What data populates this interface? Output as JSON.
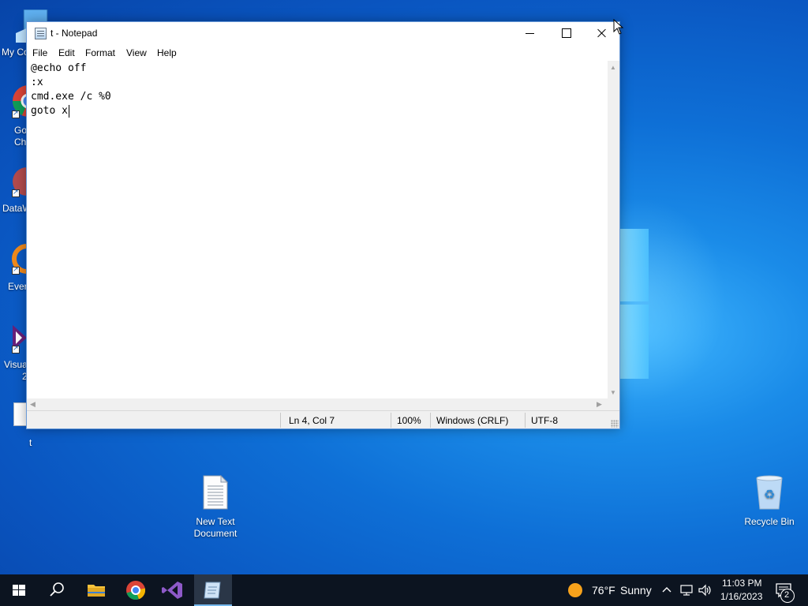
{
  "desktop": {
    "left_labels": [
      "My Co",
      "Go",
      "Ch",
      "DataW",
      "Ever",
      "Visua",
      "2"
    ],
    "file_t_label": "t",
    "new_text_doc": {
      "line1": "New Text",
      "line2": "Document"
    },
    "recycle_bin": "Recycle Bin"
  },
  "notepad": {
    "title": "t - Notepad",
    "menu": [
      "File",
      "Edit",
      "Format",
      "View",
      "Help"
    ],
    "lines": [
      "@echo off",
      ":x",
      "cmd.exe /c %0",
      "goto x"
    ],
    "status": {
      "position": "Ln 4, Col 7",
      "zoom": "100%",
      "line_ending": "Windows (CRLF)",
      "encoding": "UTF-8"
    }
  },
  "taskbar": {
    "weather_temp": "76°F",
    "weather_cond": "Sunny",
    "time": "11:03 PM",
    "date": "1/16/2023",
    "notification_count": "2"
  }
}
